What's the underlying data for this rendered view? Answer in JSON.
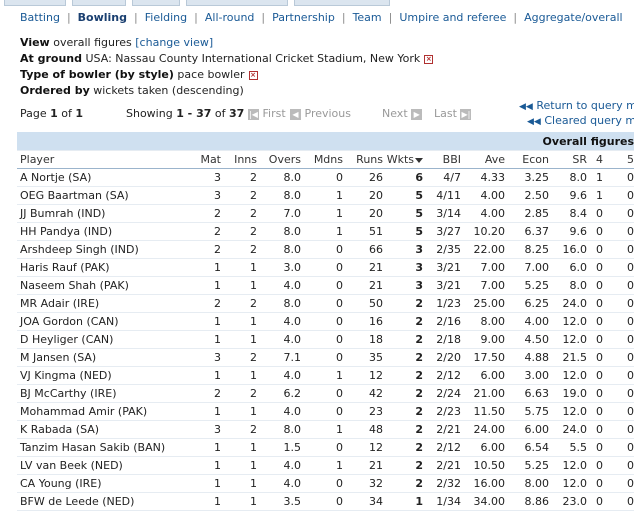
{
  "nav": {
    "tabs": [
      "Batting",
      "Bowling",
      "Fielding",
      "All-round",
      "Partnership",
      "Team",
      "Umpire and referee",
      "Aggregate/overall"
    ],
    "active": "Bowling"
  },
  "filters": {
    "view_label": "View",
    "view_value": "overall figures",
    "change_view": "[change view]",
    "ground_label": "At ground",
    "ground_value": "USA: Nassau County International Cricket Stadium, New York",
    "style_label": "Type of bowler (by style)",
    "style_value": "pace bowler",
    "order_label": "Ordered by",
    "order_value": "wickets taken (descending)"
  },
  "pager": {
    "page_text": "Page 1 of 1",
    "page_prefix": "Page",
    "page_cur": "1",
    "page_mid": "of",
    "page_total": "1",
    "showing_prefix": "Showing",
    "showing_range": "1 - 37",
    "showing_mid": "of",
    "showing_total": "37",
    "first": "First",
    "previous": "Previous",
    "next": "Next",
    "last": "Last",
    "return_link": "Return to query menu",
    "cleared_link": "Cleared query menu"
  },
  "table": {
    "caption": "Overall figures",
    "columns": [
      "Player",
      "Mat",
      "Inns",
      "Overs",
      "Mdns",
      "Runs",
      "Wkts",
      "BBI",
      "Ave",
      "Econ",
      "SR",
      "4",
      "5"
    ],
    "rows": [
      [
        "A Nortje (SA)",
        "3",
        "2",
        "8.0",
        "0",
        "26",
        "6",
        "4/7",
        "4.33",
        "3.25",
        "8.0",
        "1",
        "0"
      ],
      [
        "OEG Baartman (SA)",
        "3",
        "2",
        "8.0",
        "1",
        "20",
        "5",
        "4/11",
        "4.00",
        "2.50",
        "9.6",
        "1",
        "0"
      ],
      [
        "JJ Bumrah (IND)",
        "2",
        "2",
        "7.0",
        "1",
        "20",
        "5",
        "3/14",
        "4.00",
        "2.85",
        "8.4",
        "0",
        "0"
      ],
      [
        "HH Pandya (IND)",
        "2",
        "2",
        "8.0",
        "1",
        "51",
        "5",
        "3/27",
        "10.20",
        "6.37",
        "9.6",
        "0",
        "0"
      ],
      [
        "Arshdeep Singh (IND)",
        "2",
        "2",
        "8.0",
        "0",
        "66",
        "3",
        "2/35",
        "22.00",
        "8.25",
        "16.0",
        "0",
        "0"
      ],
      [
        "Haris Rauf (PAK)",
        "1",
        "1",
        "3.0",
        "0",
        "21",
        "3",
        "3/21",
        "7.00",
        "7.00",
        "6.0",
        "0",
        "0"
      ],
      [
        "Naseem Shah (PAK)",
        "1",
        "1",
        "4.0",
        "0",
        "21",
        "3",
        "3/21",
        "7.00",
        "5.25",
        "8.0",
        "0",
        "0"
      ],
      [
        "MR Adair (IRE)",
        "2",
        "2",
        "8.0",
        "0",
        "50",
        "2",
        "1/23",
        "25.00",
        "6.25",
        "24.0",
        "0",
        "0"
      ],
      [
        "JOA Gordon (CAN)",
        "1",
        "1",
        "4.0",
        "0",
        "16",
        "2",
        "2/16",
        "8.00",
        "4.00",
        "12.0",
        "0",
        "0"
      ],
      [
        "D Heyliger (CAN)",
        "1",
        "1",
        "4.0",
        "0",
        "18",
        "2",
        "2/18",
        "9.00",
        "4.50",
        "12.0",
        "0",
        "0"
      ],
      [
        "M Jansen (SA)",
        "3",
        "2",
        "7.1",
        "0",
        "35",
        "2",
        "2/20",
        "17.50",
        "4.88",
        "21.5",
        "0",
        "0"
      ],
      [
        "VJ Kingma (NED)",
        "1",
        "1",
        "4.0",
        "1",
        "12",
        "2",
        "2/12",
        "6.00",
        "3.00",
        "12.0",
        "0",
        "0"
      ],
      [
        "BJ McCarthy (IRE)",
        "2",
        "2",
        "6.2",
        "0",
        "42",
        "2",
        "2/24",
        "21.00",
        "6.63",
        "19.0",
        "0",
        "0"
      ],
      [
        "Mohammad Amir (PAK)",
        "1",
        "1",
        "4.0",
        "0",
        "23",
        "2",
        "2/23",
        "11.50",
        "5.75",
        "12.0",
        "0",
        "0"
      ],
      [
        "K Rabada (SA)",
        "3",
        "2",
        "8.0",
        "1",
        "48",
        "2",
        "2/21",
        "24.00",
        "6.00",
        "24.0",
        "0",
        "0"
      ],
      [
        "Tanzim Hasan Sakib (BAN)",
        "1",
        "1",
        "1.5",
        "0",
        "12",
        "2",
        "2/12",
        "6.00",
        "6.54",
        "5.5",
        "0",
        "0"
      ],
      [
        "LV van Beek (NED)",
        "1",
        "1",
        "4.0",
        "1",
        "21",
        "2",
        "2/21",
        "10.50",
        "5.25",
        "12.0",
        "0",
        "0"
      ],
      [
        "CA Young (IRE)",
        "1",
        "1",
        "4.0",
        "0",
        "32",
        "2",
        "2/32",
        "16.00",
        "8.00",
        "12.0",
        "0",
        "0"
      ],
      [
        "BFW de Leede (NED)",
        "1",
        "1",
        "3.5",
        "0",
        "34",
        "1",
        "1/34",
        "34.00",
        "8.86",
        "23.0",
        "0",
        "0"
      ]
    ]
  }
}
